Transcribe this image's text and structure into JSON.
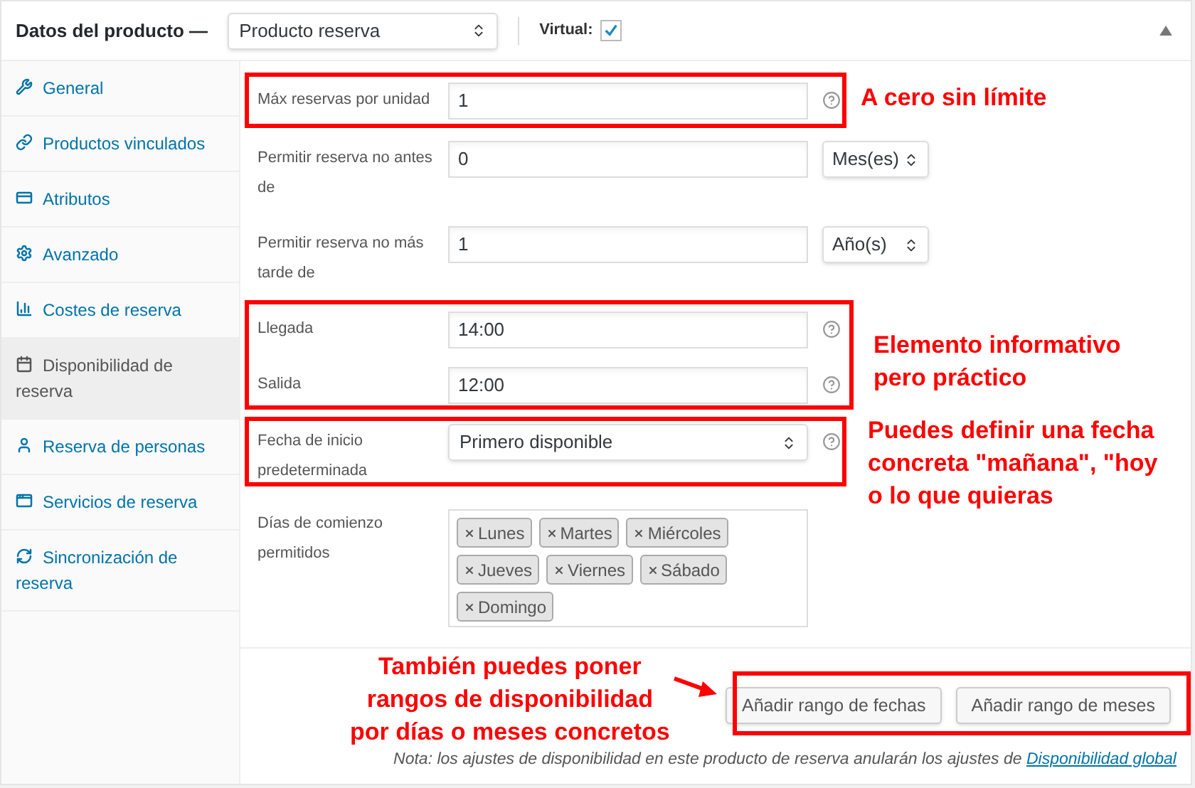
{
  "header": {
    "title": "Datos del producto —",
    "product_type": "Producto reserva",
    "virtual_label": "Virtual:",
    "virtual_checked": true
  },
  "sidebar": {
    "items": [
      {
        "label": "General",
        "selected": false
      },
      {
        "label": "Productos vinculados",
        "selected": false
      },
      {
        "label": "Atributos",
        "selected": false
      },
      {
        "label": "Avanzado",
        "selected": false
      },
      {
        "label": "Costes de reserva",
        "selected": false
      },
      {
        "label": "Disponibilidad de reserva",
        "selected": true
      },
      {
        "label": "Reserva de personas",
        "selected": false
      },
      {
        "label": "Servicios de reserva",
        "selected": false
      },
      {
        "label": "Sincronización de reserva",
        "selected": false
      }
    ]
  },
  "fields": [
    {
      "kind": "input",
      "label": "Máx reservas por unidad",
      "value": "1",
      "help": true
    },
    {
      "kind": "input_unit",
      "label": "Permitir reserva no antes de",
      "value": "0",
      "unit": "Mes(es)",
      "help": false
    },
    {
      "kind": "input_unit",
      "label": "Permitir reserva no más tarde de",
      "value": "1",
      "unit": "Año(s)",
      "help": false
    },
    {
      "kind": "input",
      "label": "Llegada",
      "value": "14:00",
      "help": true
    },
    {
      "kind": "input",
      "label": "Salida",
      "value": "12:00",
      "help": true
    },
    {
      "kind": "select",
      "label": "Fecha de inicio predeterminada",
      "value": "Primero disponible",
      "help": true
    }
  ],
  "start_days": {
    "label": "Días de comienzo permitidos",
    "tags": [
      "Lunes",
      "Martes",
      "Miércoles",
      "Jueves",
      "Viernes",
      "Sábado",
      "Domingo"
    ]
  },
  "buttons": [
    "Añadir rango de fechas",
    "Añadir rango de meses"
  ],
  "note": {
    "text": "Nota: los ajustes de disponibilidad en este producto de reserva anularán los ajustes de",
    "link": "Disponibilidad global"
  },
  "annotations": [
    {
      "lines": [
        "A cero sin límite"
      ]
    },
    {
      "lines": [
        "Elemento informativo",
        "pero práctico"
      ]
    },
    {
      "lines": [
        "Puedes definir una fecha",
        "concreta \"mañana\", \"hoy",
        "o lo que quieras"
      ]
    },
    {
      "lines": [
        "También puedes poner",
        "rangos de disponibilidad",
        "por días o meses concretos"
      ]
    }
  ]
}
